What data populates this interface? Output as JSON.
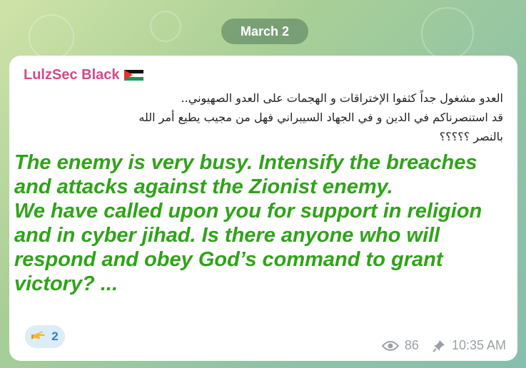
{
  "date_label": "March 2",
  "message": {
    "sender": "LulzSec Black",
    "arabic_lines": [
      "العدو مشغول جداً كثفوا الإختراقات و الهجمات على العدو الصهيوني..",
      "قد استنصرناكم في الدين و في الجهاد السيبراني فهل من مجيب يطيع أمر الله",
      "بالنصر ؟؟؟؟؟"
    ],
    "english_lines": [
      "The enemy is very busy. Intensify the breaches",
      "and attacks against the Zionist enemy.",
      "We have called upon you for support in religion",
      "and in cyber jihad. Is there anyone who will",
      "respond and obey God’s command to grant",
      "victory? ..."
    ],
    "reaction": {
      "icon": "pointing-hand-icon",
      "count": "2"
    },
    "views": "86",
    "time": "10:35 AM"
  },
  "colors": {
    "sender": "#d2498a",
    "english_text": "#2fa319",
    "reaction_bg": "#dcecf9",
    "meta": "#9aa0a6"
  }
}
